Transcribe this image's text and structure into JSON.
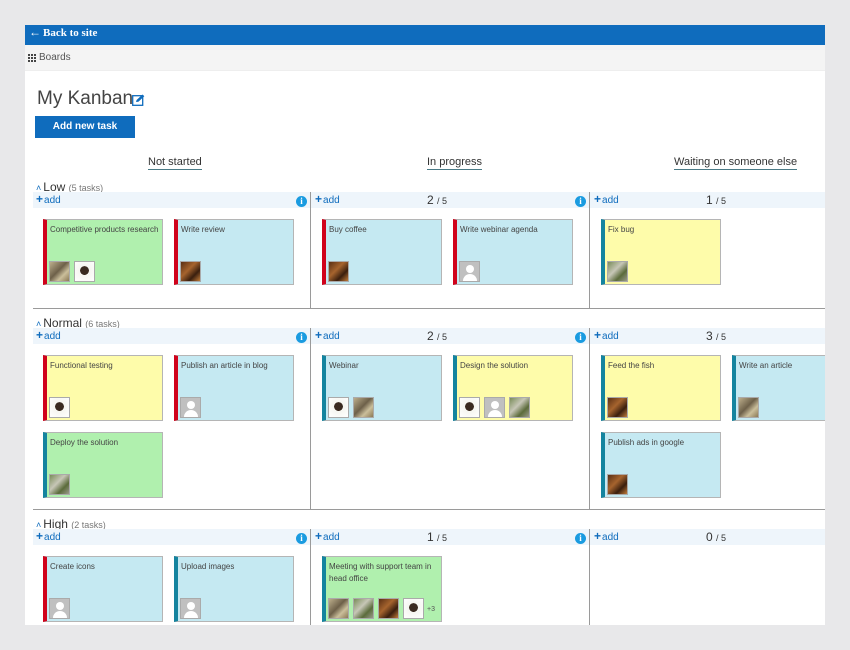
{
  "topbar": {
    "back_label": "Back to site",
    "back_icon": "arrow-left-icon"
  },
  "boardsbar": {
    "label": "Boards",
    "icon": "grid-icon"
  },
  "page": {
    "title": "My Kanban",
    "edit_icon": "edit-icon",
    "add_task_label": "Add new task"
  },
  "columns": [
    {
      "label": "Not started"
    },
    {
      "label": "In progress"
    },
    {
      "label": "Waiting on someone else"
    }
  ],
  "add_label": "add",
  "lanes": [
    {
      "name": "Low",
      "count": "(5 tasks)",
      "cells": [
        {
          "wip": "",
          "cards": [
            {
              "title": "Competitive products research",
              "color": "green",
              "priority_color": "#d0021b",
              "avatars": [
                "photo-1",
                "photo-2"
              ]
            },
            {
              "title": "Write review",
              "color": "blue",
              "priority_color": "#d0021b",
              "avatars": [
                "photo-3"
              ]
            }
          ]
        },
        {
          "wip": "2",
          "wip_max": "/ 5",
          "cards": [
            {
              "title": "Buy coffee",
              "color": "blue",
              "priority_color": "#d0021b",
              "avatars": [
                "photo-3"
              ]
            },
            {
              "title": "Write webinar agenda",
              "color": "blue",
              "priority_color": "#d0021b",
              "avatars": [
                "default"
              ]
            }
          ]
        },
        {
          "wip": "1",
          "wip_max": "/ 5",
          "cards": [
            {
              "title": "Fix bug",
              "color": "yellow",
              "priority_color": "#14849f",
              "avatars": [
                "photo-4"
              ]
            }
          ]
        }
      ]
    },
    {
      "name": "Normal",
      "count": "(6 tasks)",
      "cells": [
        {
          "wip": "",
          "cards": [
            {
              "title": "Functional testing",
              "color": "yellow",
              "priority_color": "#d0021b",
              "avatars": [
                "photo-2"
              ]
            },
            {
              "title": "Publish an article in blog",
              "color": "blue",
              "priority_color": "#d0021b",
              "avatars": [
                "default"
              ]
            },
            {
              "title": "Deploy the solution",
              "color": "green",
              "priority_color": "#14849f",
              "avatars": [
                "photo-4"
              ]
            }
          ]
        },
        {
          "wip": "2",
          "wip_max": "/ 5",
          "cards": [
            {
              "title": "Webinar",
              "color": "blue",
              "priority_color": "#14849f",
              "avatars": [
                "photo-2",
                "photo-1"
              ]
            },
            {
              "title": "Design the solution",
              "color": "yellow",
              "priority_color": "#14849f",
              "avatars": [
                "photo-2",
                "default",
                "photo-4"
              ]
            }
          ]
        },
        {
          "wip": "3",
          "wip_max": "/ 5",
          "cards": [
            {
              "title": "Feed the fish",
              "color": "yellow",
              "priority_color": "#14849f",
              "avatars": [
                "photo-3"
              ]
            },
            {
              "title": "Write an article",
              "color": "blue",
              "priority_color": "#14849f",
              "avatars": [
                "photo-1"
              ]
            },
            {
              "title": "Publish ads in google",
              "color": "blue",
              "priority_color": "#14849f",
              "avatars": [
                "photo-3"
              ]
            }
          ]
        }
      ]
    },
    {
      "name": "High",
      "count": "(2 tasks)",
      "cells": [
        {
          "wip": "",
          "cards": [
            {
              "title": "Create icons",
              "color": "blue",
              "priority_color": "#d0021b",
              "avatars": [
                "default"
              ]
            },
            {
              "title": "Upload images",
              "color": "blue",
              "priority_color": "#14849f",
              "avatars": [
                "default"
              ]
            }
          ]
        },
        {
          "wip": "1",
          "wip_max": "/ 5",
          "cards": [
            {
              "title": "Meeting with support team in head office",
              "color": "green",
              "priority_color": "#14849f",
              "avatars": [
                "photo-1",
                "photo-4",
                "photo-3",
                "photo-2"
              ],
              "more": "+3"
            }
          ]
        },
        {
          "wip": "0",
          "wip_max": "/ 5",
          "cards": []
        }
      ]
    }
  ],
  "colors": {
    "brand_blue": "#0f6cbd",
    "card_green": "#b0f0ae",
    "card_blue": "#c5e9f2",
    "card_yellow": "#fefcaa",
    "priority_red": "#d0021b",
    "priority_teal": "#14849f",
    "info_blue": "#1a9be0"
  }
}
